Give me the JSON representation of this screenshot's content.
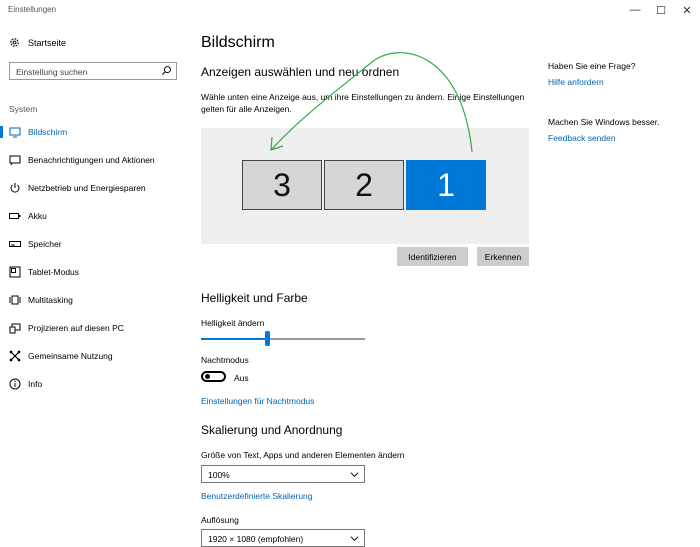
{
  "window": {
    "title": "Einstellungen",
    "minimize": "—",
    "maximize": "☐",
    "close": "✕"
  },
  "sidebar": {
    "home_label": "Startseite",
    "search_placeholder": "Einstellung suchen",
    "section": "System",
    "items": [
      {
        "label": "Bildschirm",
        "icon": "display-icon",
        "active": true
      },
      {
        "label": "Benachrichtigungen und Aktionen",
        "icon": "notification-icon"
      },
      {
        "label": "Netzbetrieb und Energiesparen",
        "icon": "power-icon"
      },
      {
        "label": "Akku",
        "icon": "battery-icon"
      },
      {
        "label": "Speicher",
        "icon": "storage-icon"
      },
      {
        "label": "Tablet-Modus",
        "icon": "tablet-icon"
      },
      {
        "label": "Multitasking",
        "icon": "multitasking-icon"
      },
      {
        "label": "Projizieren auf diesen PC",
        "icon": "project-icon"
      },
      {
        "label": "Gemeinsame Nutzung",
        "icon": "share-icon"
      },
      {
        "label": "Info",
        "icon": "info-icon"
      }
    ]
  },
  "main": {
    "title": "Bildschirm",
    "arrange": {
      "heading": "Anzeigen auswählen und neu ordnen",
      "description": "Wähle unten eine Anzeige aus, um ihre Einstellungen zu ändern. Einige Einstellungen gelten für alle Anzeigen.",
      "monitors": [
        {
          "number": "3",
          "selected": false
        },
        {
          "number": "2",
          "selected": false
        },
        {
          "number": "1",
          "selected": true
        }
      ],
      "identify_label": "Identifizieren",
      "detect_label": "Erkennen"
    },
    "brightness": {
      "heading": "Helligkeit und Farbe",
      "label": "Helligkeit ändern",
      "level_percent": 40,
      "night_label": "Nachtmodus",
      "night_state": "Aus",
      "night_link": "Einstellungen für Nachtmodus"
    },
    "scale": {
      "heading": "Skalierung und Anordnung",
      "size_label": "Größe von Text, Apps und anderen Elementen ändern",
      "size_value": "100%",
      "custom_link": "Benutzerdefinierte Skalierung",
      "resolution_label": "Auflösung",
      "resolution_value": "1920 × 1080 (empfohlen)"
    }
  },
  "aside": {
    "question": "Haben Sie eine Frage?",
    "help_link": "Hilfe anfordern",
    "improve": "Machen Sie Windows besser.",
    "feedback_link": "Feedback senden"
  },
  "colors": {
    "accent": "#0078d7",
    "link": "#0063b1",
    "annotation_arrow": "#2eaa4a"
  }
}
